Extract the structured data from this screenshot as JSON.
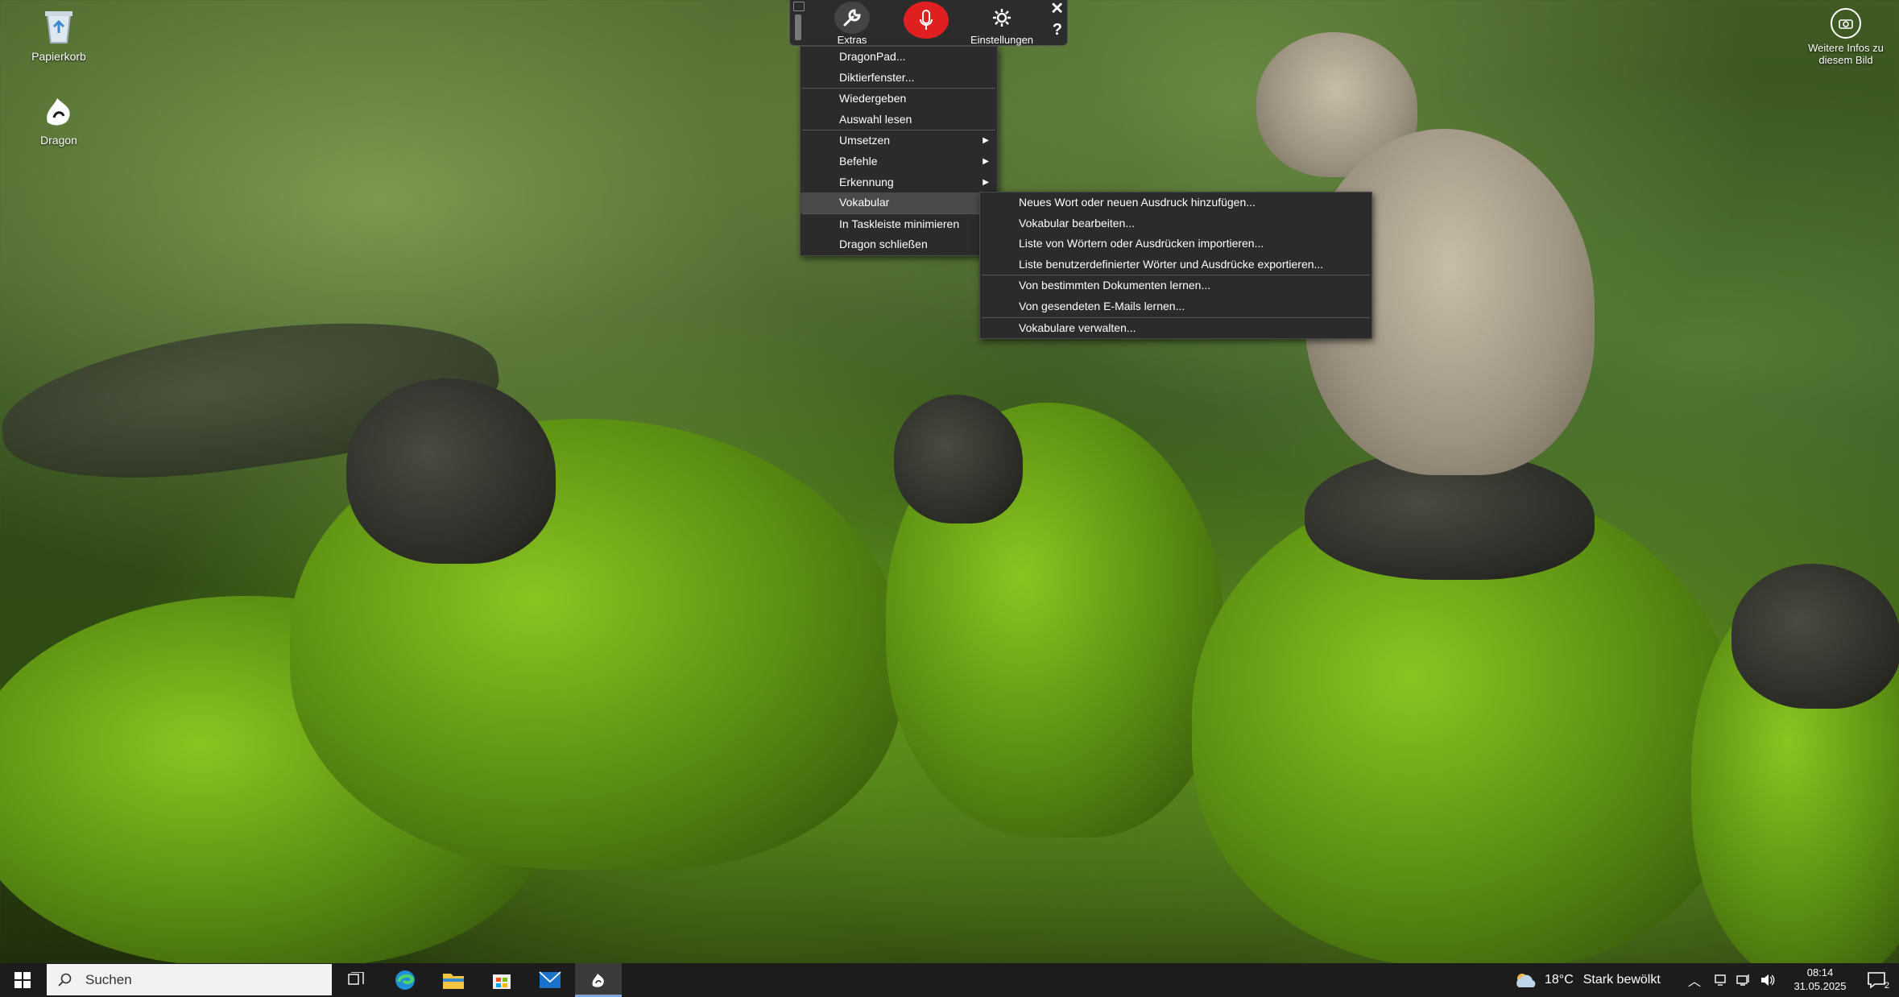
{
  "desktop": {
    "icons": [
      {
        "label": "Papierkorb",
        "icon": "recycle-bin-icon"
      },
      {
        "label": "Dragon",
        "icon": "dragon-icon"
      }
    ],
    "info": {
      "label": "Weitere Infos zu diesem Bild",
      "icon": "camera-icon"
    }
  },
  "dragon_bar": {
    "extras": "Extras",
    "settings": "Einstellungen",
    "help": "?",
    "close": "✕",
    "mic_state": "off",
    "mic_color": "#e02020"
  },
  "menu": {
    "items": [
      {
        "label": "DragonPad..."
      },
      {
        "label": "Diktierfenster..."
      },
      {
        "label": "Wiedergeben"
      },
      {
        "label": "Auswahl lesen"
      },
      {
        "label": "Umsetzen",
        "submenu": true
      },
      {
        "label": "Befehle",
        "submenu": true
      },
      {
        "label": "Erkennung",
        "submenu": true
      },
      {
        "label": "Vokabular",
        "active": true
      },
      {
        "label": "In Taskleiste minimieren"
      },
      {
        "label": "Dragon schließen"
      }
    ],
    "submenu_arrow": "▶"
  },
  "submenu": {
    "items": [
      {
        "label": "Neues Wort oder neuen Ausdruck hinzufügen..."
      },
      {
        "label": "Vokabular bearbeiten..."
      },
      {
        "label": "Liste von Wörtern oder Ausdrücken importieren..."
      },
      {
        "label": "Liste benutzerdefinierter Wörter und Ausdrücke exportieren..."
      },
      {
        "label": "Von bestimmten Dokumenten lernen..."
      },
      {
        "label": "Von gesendeten E-Mails lernen..."
      },
      {
        "label": "Vokabulare verwalten..."
      }
    ]
  },
  "taskbar": {
    "search_placeholder": "Suchen",
    "weather_temp": "18°C",
    "weather_text": "Stark bewölkt",
    "time": "08:14",
    "date": "31.05.2025",
    "notification_count": "2",
    "apps": [
      "task-view",
      "edge",
      "file-explorer",
      "store",
      "mail",
      "dragon"
    ]
  }
}
